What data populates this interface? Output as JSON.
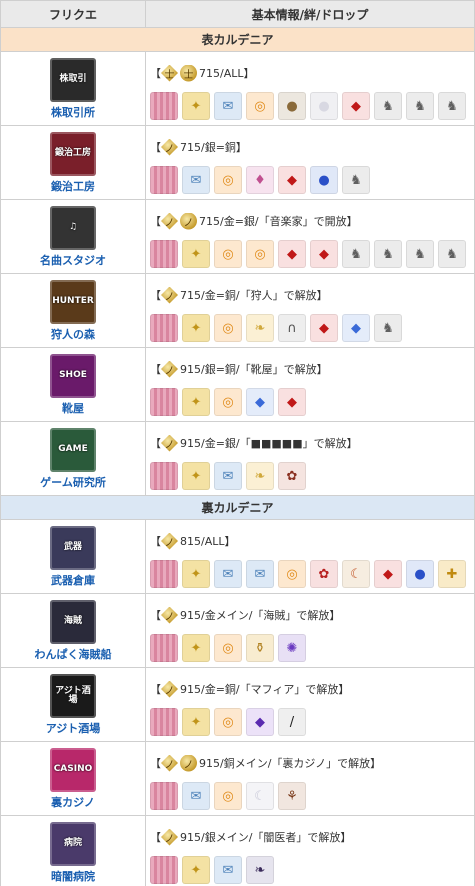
{
  "header": {
    "col1": "フリクエ",
    "col2": "基本情報/絆/ドロップ"
  },
  "sections": [
    {
      "title": "表カルデニア",
      "rows": [
        {
          "name": "株取引所",
          "logo": {
            "text": "株取引",
            "bg": "#2a2a2a"
          },
          "badges": [
            "士",
            "士"
          ],
          "text": "715/ALL】",
          "drops": [
            "pink-item",
            "bond-item",
            "ticket-icon",
            "ring-icon",
            "ball-icon",
            "pearl-icon",
            "ruby-icon",
            "statue-icon",
            "statue-icon",
            "statue-icon"
          ]
        },
        {
          "name": "鍛治工房",
          "logo": {
            "text": "鍛治工房",
            "bg": "#7a1f2a"
          },
          "badges": [
            "ノ"
          ],
          "text": "715/銀=銅】",
          "drops": [
            "pink-item",
            "ticket-icon",
            "ring-icon",
            "flask-icon",
            "ruby-icon",
            "sapphire-icon",
            "statue-icon"
          ]
        },
        {
          "name": "名曲スタジオ",
          "logo": {
            "text": "♫",
            "bg": "#333333"
          },
          "badges": [
            "ノ",
            "ノ"
          ],
          "text": "715/金=銀/「音楽家」で開放】",
          "drops": [
            "pink-item",
            "bond-item",
            "ring-icon",
            "ring-icon",
            "ruby-icon",
            "ruby-icon",
            "statue-icon",
            "statue-icon",
            "statue-icon",
            "statue-icon"
          ]
        },
        {
          "name": "狩人の森",
          "logo": {
            "text": "HUNTER",
            "bg": "#5a3a1a"
          },
          "badges": [
            "ノ"
          ],
          "text": "715/金=銅/「狩人」で解放】",
          "drops": [
            "pink-item",
            "bond-item",
            "ring-icon",
            "feather-icon",
            "horseshoe-icon",
            "ruby-icon",
            "blue-gem-icon",
            "statue-icon"
          ]
        },
        {
          "name": "靴屋",
          "logo": {
            "text": "SHOE",
            "bg": "#6a1a6a"
          },
          "badges": [
            "ノ"
          ],
          "text": "915/銀=銅/「靴屋」で解放】",
          "drops": [
            "pink-item",
            "bond-item",
            "ring-icon",
            "blue-gem-icon",
            "ruby-icon"
          ]
        },
        {
          "name": "ゲーム研究所",
          "logo": {
            "text": "GAME",
            "bg": "#2a5a3a"
          },
          "badges": [
            "ノ"
          ],
          "text": "915/金=銀/「■■■■■」で解放】",
          "drops": [
            "pink-item",
            "bond-item",
            "ticket-icon",
            "feather-icon",
            "gem-icon"
          ]
        }
      ]
    },
    {
      "title": "裏カルデニア",
      "rows": [
        {
          "name": "武器倉庫",
          "logo": {
            "text": "武器",
            "bg": "#3a3a5a"
          },
          "badges": [
            "ノ"
          ],
          "text": "815/ALL】",
          "drops": [
            "pink-item",
            "bond-item",
            "ticket-icon",
            "ticket-icon",
            "ring-icon",
            "rose-icon",
            "sickle-icon",
            "ruby-icon",
            "sapphire-icon",
            "gold-item"
          ]
        },
        {
          "name": "わんぱく海賊船",
          "logo": {
            "text": "海賊",
            "bg": "#2a2a3a"
          },
          "badges": [
            "ノ"
          ],
          "text": "915/金メイン/「海賊」で解放】",
          "drops": [
            "pink-item",
            "bond-item",
            "ring-icon",
            "jar-icon",
            "orb-icon"
          ]
        },
        {
          "name": "アジト酒場",
          "logo": {
            "text": "アジト酒場",
            "bg": "#1a1a1a"
          },
          "badges": [
            "ノ"
          ],
          "text": "915/金=銅/「マフィア」で解放】",
          "drops": [
            "pink-item",
            "bond-item",
            "ring-icon",
            "violet-gem-icon",
            "knife-icon"
          ]
        },
        {
          "name": "裏カジノ",
          "logo": {
            "text": "CASINO",
            "bg": "#b8286a"
          },
          "badges": [
            "ノ",
            "ノ"
          ],
          "text": "915/銅メイン/「裏カジノ」で解放】",
          "drops": [
            "pink-item",
            "ticket-icon",
            "ring-icon",
            "moon-icon",
            "fork-icon"
          ]
        },
        {
          "name": "暗闇病院",
          "logo": {
            "text": "病院",
            "bg": "#4a3a6a"
          },
          "badges": [
            "ノ"
          ],
          "text": "915/銀メイン/「闇医者」で解放】",
          "drops": [
            "pink-item",
            "bond-item",
            "ticket-icon",
            "dark-feather-icon"
          ]
        }
      ]
    }
  ]
}
